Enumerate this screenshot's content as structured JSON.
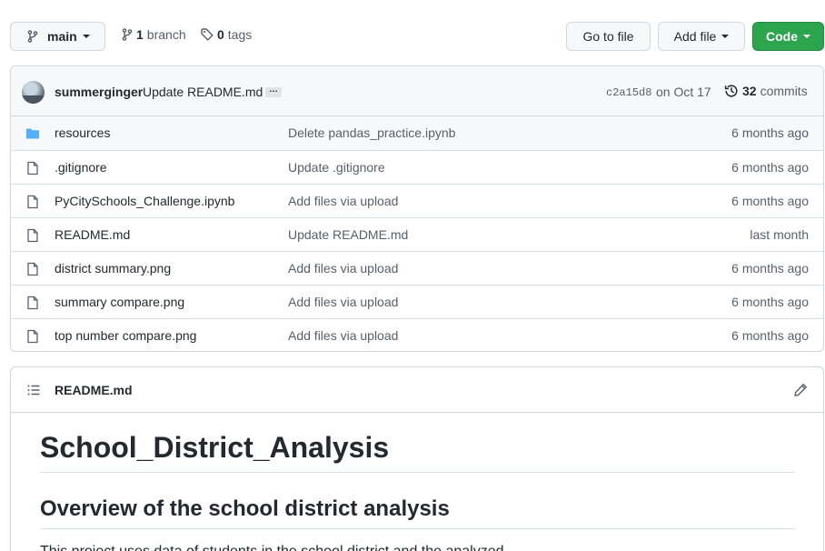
{
  "toolbar": {
    "branch_name": "main",
    "branch_count": "1",
    "branch_label": "branch",
    "tag_count": "0",
    "tag_label": "tags",
    "goto_file": "Go to file",
    "add_file": "Add file",
    "code": "Code"
  },
  "commit": {
    "author": "summerginger",
    "message": "Update README.md",
    "ellipsis": "…",
    "sha": "c2a15d8",
    "date": "on Oct 17",
    "count": "32",
    "count_label": "commits"
  },
  "files": [
    {
      "type": "folder",
      "name": "resources",
      "message": "Delete pandas_practice.ipynb",
      "age": "6 months ago"
    },
    {
      "type": "file",
      "name": ".gitignore",
      "message": "Update .gitignore",
      "age": "6 months ago"
    },
    {
      "type": "file",
      "name": "PyCitySchools_Challenge.ipynb",
      "message": "Add files via upload",
      "age": "6 months ago"
    },
    {
      "type": "file",
      "name": "README.md",
      "message": "Update README.md",
      "age": "last month"
    },
    {
      "type": "file",
      "name": "district summary.png",
      "message": "Add files via upload",
      "age": "6 months ago"
    },
    {
      "type": "file",
      "name": "summary compare.png",
      "message": "Add files via upload",
      "age": "6 months ago"
    },
    {
      "type": "file",
      "name": "top number compare.png",
      "message": "Add files via upload",
      "age": "6 months ago"
    }
  ],
  "readme": {
    "filename": "README.md",
    "h1": "School_District_Analysis",
    "h2": "Overview of the school district analysis",
    "para": "This project uses data of students in the school district and the analyzed"
  },
  "colors": {
    "code_button": "#2da44e",
    "folder_icon": "#54aeff",
    "muted_text": "#57606a"
  }
}
